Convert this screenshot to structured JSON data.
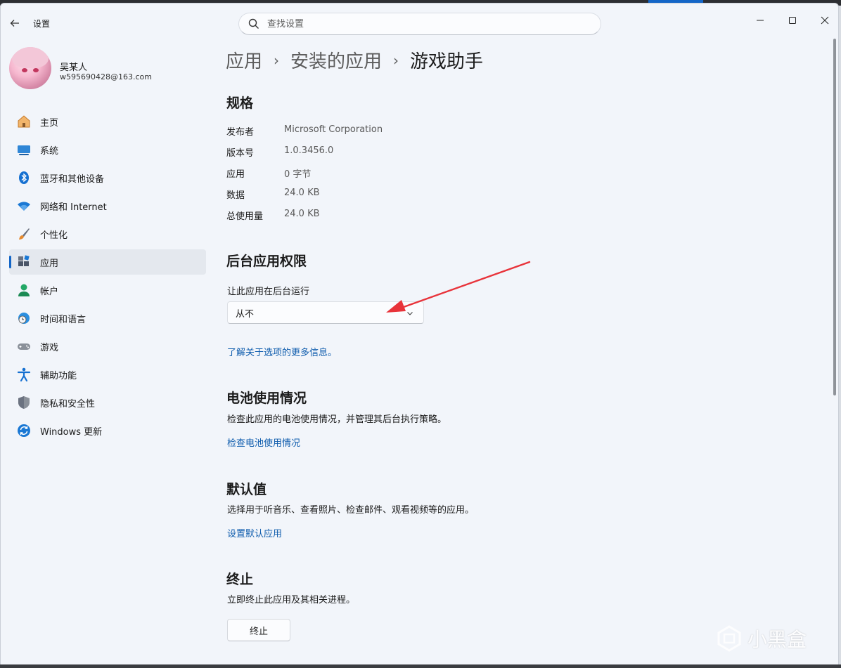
{
  "window": {
    "title": "设置",
    "controls": {
      "minimize": "—",
      "maximize": "☐",
      "close": "✕"
    }
  },
  "search": {
    "placeholder": "查找设置"
  },
  "profile": {
    "name": "吴某人",
    "email": "w595690428@163.com"
  },
  "nav": {
    "items": [
      {
        "label": "主页",
        "icon": "home-icon"
      },
      {
        "label": "系统",
        "icon": "system-icon"
      },
      {
        "label": "蓝牙和其他设备",
        "icon": "bluetooth-icon"
      },
      {
        "label": "网络和 Internet",
        "icon": "wifi-icon"
      },
      {
        "label": "个性化",
        "icon": "brush-icon"
      },
      {
        "label": "应用",
        "icon": "apps-icon",
        "active": true
      },
      {
        "label": "帐户",
        "icon": "account-icon"
      },
      {
        "label": "时间和语言",
        "icon": "clock-globe-icon"
      },
      {
        "label": "游戏",
        "icon": "gamepad-icon"
      },
      {
        "label": "辅助功能",
        "icon": "accessibility-icon"
      },
      {
        "label": "隐私和安全性",
        "icon": "shield-icon"
      },
      {
        "label": "Windows 更新",
        "icon": "update-icon"
      }
    ]
  },
  "breadcrumb": {
    "items": [
      "应用",
      "安装的应用",
      "游戏助手"
    ],
    "separator": "›"
  },
  "specs": {
    "title": "规格",
    "rows": [
      {
        "key": "发布者",
        "value": "Microsoft Corporation"
      },
      {
        "key": "版本号",
        "value": "1.0.3456.0"
      },
      {
        "key": "应用",
        "value": "0 字节"
      },
      {
        "key": "数据",
        "value": "24.0 KB"
      },
      {
        "key": "总使用量",
        "value": "24.0 KB"
      }
    ]
  },
  "background": {
    "title": "后台应用权限",
    "label": "让此应用在后台运行",
    "selected": "从不",
    "link": "了解关于选项的更多信息。"
  },
  "battery": {
    "title": "电池使用情况",
    "desc": "检查此应用的电池使用情况，并管理其后台执行策略。",
    "link": "检查电池使用情况"
  },
  "defaults": {
    "title": "默认值",
    "desc": "选择用于听音乐、查看照片、检查邮件、观看视频等的应用。",
    "link": "设置默认应用"
  },
  "terminate": {
    "title": "终止",
    "desc": "立即终止此应用及其相关进程。",
    "button": "终止"
  },
  "watermark": {
    "text": "小黑盒"
  },
  "colors": {
    "accent": "#1466c7",
    "link": "#0e5cad",
    "annotation": "#e8333a"
  }
}
